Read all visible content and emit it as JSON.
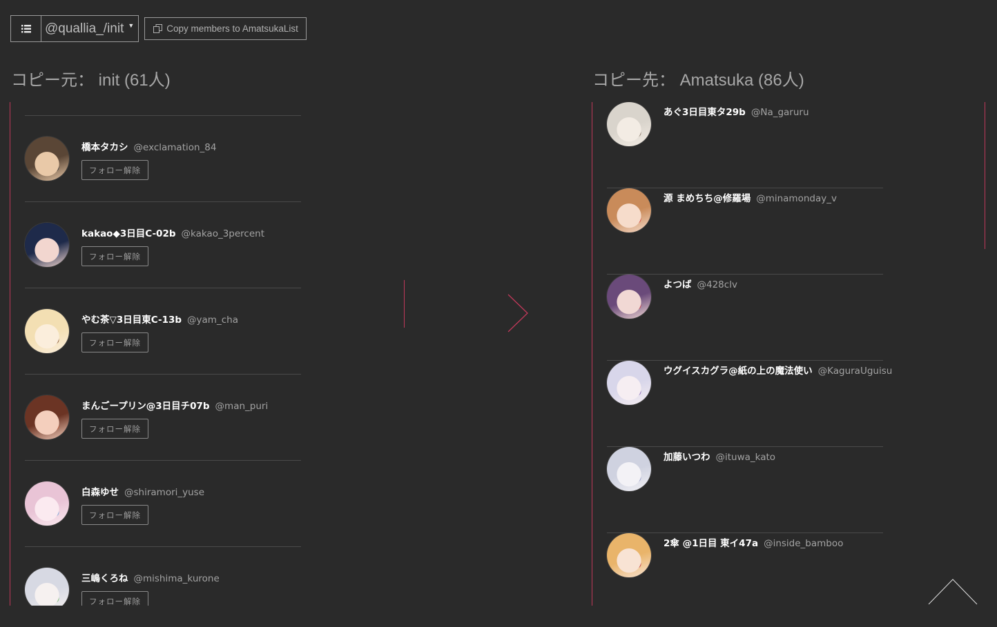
{
  "toolbar": {
    "account": "@quallia_/init",
    "copy_label": "Copy members to AmatsukaList"
  },
  "source": {
    "heading": "コピー元： init (61人)",
    "unfollow_label": "フォロー解除",
    "users": [
      {
        "name": "橋本タカシ",
        "handle": "@exclamation_84",
        "colors": [
          "#5a4636",
          "#e9c9a8",
          "#3b3b3b"
        ]
      },
      {
        "name": "kakao◆3日目C-02b",
        "handle": "@kakao_3percent",
        "colors": [
          "#1e2a4a",
          "#f2d6cf",
          "#6a83b8"
        ]
      },
      {
        "name": "やむ茶▽3日目東C-13b",
        "handle": "@yam_cha",
        "colors": [
          "#f3dfb3",
          "#fbeedc",
          "#8a5a3a"
        ]
      },
      {
        "name": "まんごープリン@3日目チ07b",
        "handle": "@man_puri",
        "colors": [
          "#6b3424",
          "#f4cfbd",
          "#b55a3a"
        ]
      },
      {
        "name": "白森ゆせ",
        "handle": "@shiramori_yuse",
        "colors": [
          "#e9c4d6",
          "#fbeaf0",
          "#7aa4d6"
        ]
      },
      {
        "name": "三嶋くろね",
        "handle": "@mishima_kurone",
        "colors": [
          "#d7d9e3",
          "#f6f1f0",
          "#7ab872"
        ]
      }
    ]
  },
  "destination": {
    "heading": "コピー先： Amatsuka (86人)",
    "users": [
      {
        "name": "あぐ3日目東タ29b",
        "handle": "@Na_garuru",
        "colors": [
          "#d9d4cc",
          "#f3ece4",
          "#8a7a6a"
        ]
      },
      {
        "name": "源 まめちち@修羅場",
        "handle": "@minamonday_v",
        "colors": [
          "#c98b5a",
          "#f6dccb",
          "#d6453a"
        ]
      },
      {
        "name": "よつば",
        "handle": "@428clv",
        "colors": [
          "#6a4a7a",
          "#f1d8d4",
          "#c03a4a"
        ]
      },
      {
        "name": "ウグイスカグラ@紙の上の魔法使い",
        "handle": "@KaguraUguisu",
        "colors": [
          "#d8d6ea",
          "#f6eef2",
          "#8a6ab8"
        ]
      },
      {
        "name": "加藤いつわ",
        "handle": "@ituwa_kato",
        "colors": [
          "#cfd2e0",
          "#f3f2f6",
          "#9aa0c8"
        ]
      },
      {
        "name": "2傘 @1日目 東イ47a",
        "handle": "@inside_bamboo",
        "colors": [
          "#e9b46a",
          "#f8e3d4",
          "#c03a3a"
        ]
      }
    ]
  },
  "colors": {
    "accent": "#c0395a",
    "background": "#2a2a2a"
  },
  "icons": {
    "list_toggle": "list-icon",
    "copy": "copy-icon",
    "arrow": "chevron-right-icon",
    "scroll_top": "chevron-up-icon"
  }
}
